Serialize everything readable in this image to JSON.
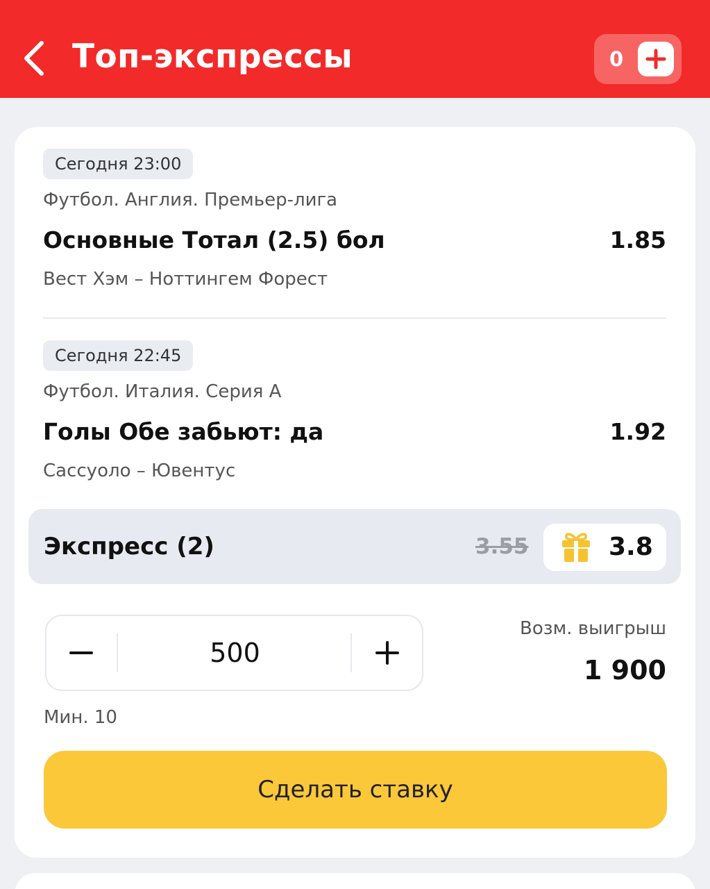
{
  "header": {
    "title": "Топ-экспрессы",
    "back_icon": "chevron-left-icon",
    "balance_count": "0",
    "add_icon": "plus-icon",
    "color": "#f22a2a"
  },
  "bets": [
    {
      "time": "Сегодня 23:00",
      "league": "Футбол. Англия. Премьер-лига",
      "market": "Основные Тотал (2.5) бол",
      "odds": "1.85",
      "teams": "Вест Хэм – Ноттингем Форест"
    },
    {
      "time": "Сегодня 22:45",
      "league": "Футбол. Италия. Серия А",
      "market": "Голы Обе забьют: да",
      "odds": "1.92",
      "teams": "Сассуоло – Ювентус"
    }
  ],
  "express": {
    "label": "Экспресс (2)",
    "old_odds": "3.55",
    "boost_icon": "gift-icon",
    "new_odds": "3.8"
  },
  "stake": {
    "value": "500",
    "minus_icon": "minus-icon",
    "plus_icon": "plus-icon",
    "min_label": "Мин. 10"
  },
  "win": {
    "label": "Возм. выигрыш",
    "value": "1 900"
  },
  "place_bet": {
    "label": "Сделать ставку",
    "color": "#fbc83a"
  }
}
